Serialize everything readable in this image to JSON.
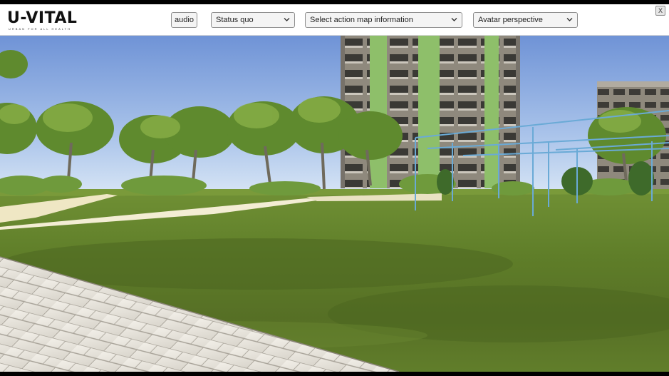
{
  "app": {
    "logo_text": "U-VITAL",
    "logo_tagline": "URBAN  FOR  ALL  HEALTH"
  },
  "toolbar": {
    "audio_label": "audio",
    "scenario_select": {
      "selected": "Status quo"
    },
    "action_map_select": {
      "selected": "Select action map information"
    },
    "perspective_select": {
      "selected": "Avatar perspective"
    },
    "close_label": "X"
  },
  "scene": {
    "description_icons": [
      "tree-icon",
      "building-icon",
      "path-icon",
      "fitness-bars-icon"
    ],
    "colors": {
      "sky_top": "#7d9ed9",
      "sky_bottom": "#cfe0f5",
      "grass": "#5e7d2a",
      "path": "#f2ecd2",
      "pavement": "#e8e4dc",
      "building_facade": "#8a8478",
      "building_accent": "#8fb86a",
      "bars": "#6aaad6"
    }
  }
}
